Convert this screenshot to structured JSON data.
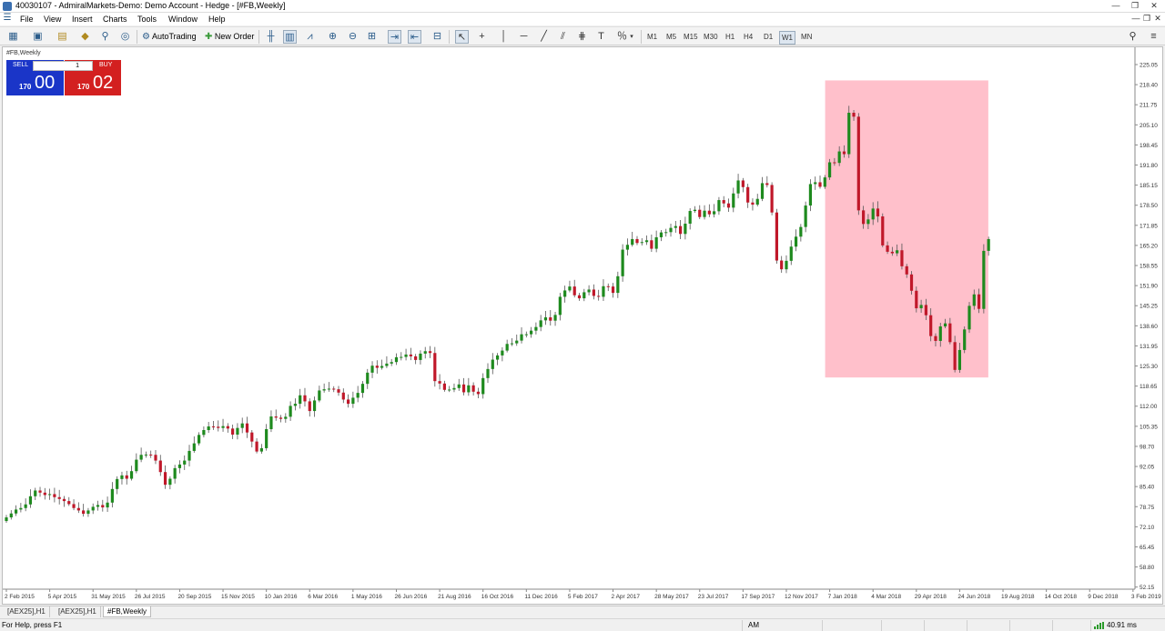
{
  "window": {
    "title": "40030107 - AdmiralMarkets-Demo: Demo Account - Hedge - [#FB,Weekly]",
    "controls": [
      "—",
      "❐",
      "✕"
    ],
    "inner_controls": [
      "—",
      "❐",
      "✕"
    ]
  },
  "menu": [
    "File",
    "View",
    "Insert",
    "Charts",
    "Tools",
    "Window",
    "Help"
  ],
  "toolbar": {
    "autotrading_label": "AutoTrading",
    "new_order_label": "New Order",
    "timeframes": [
      "M1",
      "M5",
      "M15",
      "M30",
      "H1",
      "H4",
      "D1",
      "W1",
      "MN"
    ],
    "active_timeframe": "W1"
  },
  "chart_header": {
    "symbol_label": "#FB,Weekly"
  },
  "trade_panel": {
    "sell_label": "SELL",
    "buy_label": "BUY",
    "lot_value": "1",
    "sell_price_small": "170",
    "sell_price_big": "00",
    "buy_price_small": "170",
    "buy_price_big": "02"
  },
  "colors": {
    "bull": "#1e8a1e",
    "bear": "#c0182a",
    "highlight": "#ffc0cb",
    "sell": "#1a35c8",
    "buy": "#d32020"
  },
  "chart_data": {
    "type": "candlestick",
    "y_ticks": [
      "225.05",
      "218.40",
      "211.75",
      "205.10",
      "198.45",
      "191.80",
      "185.15",
      "178.50",
      "171.85",
      "165.20",
      "158.55",
      "151.90",
      "145.25",
      "138.60",
      "131.95",
      "125.30",
      "118.65",
      "112.00",
      "105.35",
      "98.70",
      "92.05",
      "85.40",
      "78.75",
      "72.10",
      "65.45",
      "58.80",
      "52.15"
    ],
    "ylim": [
      48.85,
      228.35
    ],
    "x_ticks": [
      "2 Feb 2015",
      "5 Apr 2015",
      "31 May 2015",
      "26 Jul 2015",
      "20 Sep 2015",
      "15 Nov 2015",
      "10 Jan 2016",
      "6 Mar 2016",
      "1 May 2016",
      "26 Jun 2016",
      "21 Aug 2016",
      "16 Oct 2016",
      "11 Dec 2016",
      "5 Feb 2017",
      "2 Apr 2017",
      "28 May 2017",
      "23 Jul 2017",
      "17 Sep 2017",
      "12 Nov 2017",
      "7 Jan 2018",
      "4 Mar 2018",
      "29 Apr 2018",
      "24 Jun 2018",
      "19 Aug 2018",
      "14 Oct 2018",
      "9 Dec 2018",
      "3 Feb 2019"
    ],
    "highlight_range": {
      "from_week": 171,
      "to_week": 203,
      "low": 121.5,
      "high": 219.8
    },
    "closes": [
      75.2,
      76.5,
      77.8,
      78.3,
      79.5,
      82.2,
      84.1,
      83.4,
      82.6,
      82.9,
      81.9,
      81.3,
      80.6,
      79.6,
      78.3,
      77.5,
      76.4,
      77.5,
      78.7,
      79.3,
      78.5,
      80.1,
      84.6,
      87.9,
      89.1,
      88.0,
      90.5,
      94.3,
      95.9,
      96.0,
      95.9,
      94.0,
      90.2,
      86.0,
      88.0,
      91.5,
      92.7,
      94.0,
      97.2,
      99.7,
      102.5,
      104.1,
      105.3,
      105.2,
      104.8,
      105.4,
      104.6,
      102.6,
      104.8,
      106.3,
      103.3,
      100.3,
      97.0,
      98.1,
      104.4,
      108.6,
      108.2,
      107.8,
      108.5,
      112.1,
      112.8,
      115.6,
      113.6,
      110.4,
      113.9,
      117.2,
      117.6,
      117.8,
      117.6,
      116.5,
      114.2,
      112.8,
      114.8,
      116.4,
      119.4,
      123.1,
      125.4,
      124.7,
      125.3,
      126.1,
      126.6,
      128.2,
      128.3,
      129.1,
      128.5,
      127.3,
      129.4,
      130.2,
      129.6,
      120.3,
      119.5,
      117.4,
      117.5,
      118.0,
      119.2,
      116.6,
      118.9,
      116.8,
      116.0,
      121.3,
      124.3,
      127.4,
      128.8,
      130.4,
      132.6,
      132.8,
      133.7,
      135.8,
      135.8,
      137.0,
      138.2,
      140.4,
      141.4,
      140.3,
      142.2,
      148.2,
      150.3,
      151.6,
      148.7,
      147.7,
      149.7,
      150.6,
      148.5,
      148.2,
      151.7,
      151.6,
      149.5,
      155.0,
      163.8,
      165.4,
      167.3,
      166.0,
      166.3,
      166.9,
      164.1,
      167.9,
      169.5,
      169.6,
      171.0,
      171.6,
      169.0,
      172.4,
      176.6,
      177.0,
      174.6,
      176.7,
      175.5,
      176.5,
      180.2,
      179.1,
      177.7,
      182.4,
      186.7,
      184.5,
      179.4,
      178.7,
      180.6,
      185.8,
      185.2,
      176.1,
      160.2,
      157.3,
      160.1,
      164.8,
      168.1,
      171.3,
      178.4,
      185.5,
      186.1,
      184.6,
      187.7,
      192.7,
      192.5,
      196.3,
      195.4,
      209.1,
      207.8,
      176.8,
      172.3,
      173.8,
      177.4,
      174.8,
      165.2,
      163.1,
      162.6,
      163.6,
      158.3,
      155.6,
      150.2,
      144.4,
      145.5,
      142.1,
      135.2,
      133.6,
      138.4,
      139.4,
      133.2,
      124.0,
      130.6,
      137.4,
      145.2,
      149.0,
      144.2,
      163.4,
      167.3
    ]
  },
  "tabs": [
    "[AEX25],H1",
    "[AEX25],H1",
    "#FB,Weekly"
  ],
  "status": {
    "help": "For Help, press F1",
    "profile": "AM",
    "connection": "40.91 ms"
  }
}
